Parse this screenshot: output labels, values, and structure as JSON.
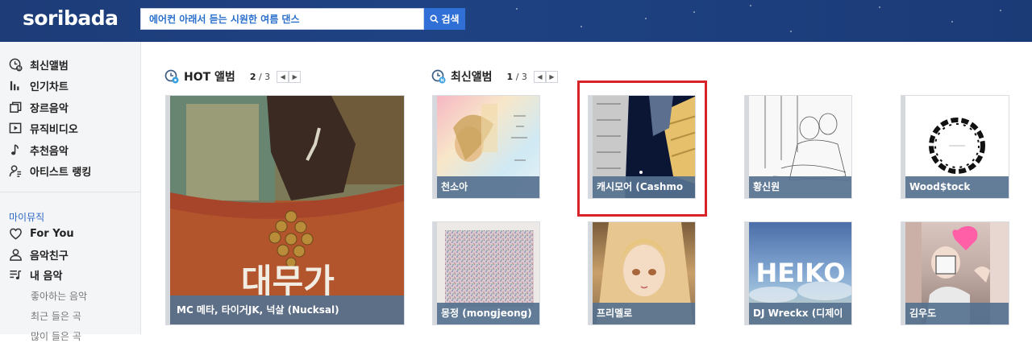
{
  "header": {
    "logo": "soribada",
    "search_value": "에어컨 아래서 듣는 시원한 여름 댄스",
    "search_button_label": "검색"
  },
  "sidebar": {
    "items": [
      {
        "label": "최신앨범",
        "icon": "new-clock-icon"
      },
      {
        "label": "인기차트",
        "icon": "chart-bars-icon"
      },
      {
        "label": "장르음악",
        "icon": "layers-icon"
      },
      {
        "label": "뮤직비디오",
        "icon": "play-box-icon"
      },
      {
        "label": "추천음악",
        "icon": "music-note-icon"
      },
      {
        "label": "아티스트 랭킹",
        "icon": "artist-icon"
      }
    ],
    "my_music_title": "마이뮤직",
    "my_items": [
      {
        "label": "For You",
        "icon": "heart-icon"
      },
      {
        "label": "음악친구",
        "icon": "friends-icon"
      },
      {
        "label": "내 음악",
        "icon": "playlist-icon"
      }
    ],
    "sub_items": [
      "좋아하는 음악",
      "최근 들은 곡",
      "많이 들은 곡"
    ]
  },
  "hot": {
    "title": "HOT 앨범",
    "page_current": "2",
    "page_total": "/ 3",
    "card_caption": "MC 메타, 타이거JK, 넉살 (Nucksal)",
    "art_text": "대무가"
  },
  "new": {
    "title": "최신앨범",
    "page_current": "1",
    "page_total": "/ 3",
    "cards": [
      {
        "caption": "천소아"
      },
      {
        "caption": "캐시모어 (Cashmo"
      },
      {
        "caption": "황신원"
      },
      {
        "caption": "Wood$tock"
      },
      {
        "caption": "몽정 (mongjeong)"
      },
      {
        "caption": "프리멜로"
      },
      {
        "caption": "DJ Wreckx (디제이"
      },
      {
        "caption": "김우도"
      }
    ],
    "heiko_text": "HEIKO"
  },
  "colors": {
    "header_bg": "#1e4283",
    "accent_blue": "#2f6fd6",
    "caption_bg": "#56718f",
    "highlight_red": "#d8232a"
  }
}
